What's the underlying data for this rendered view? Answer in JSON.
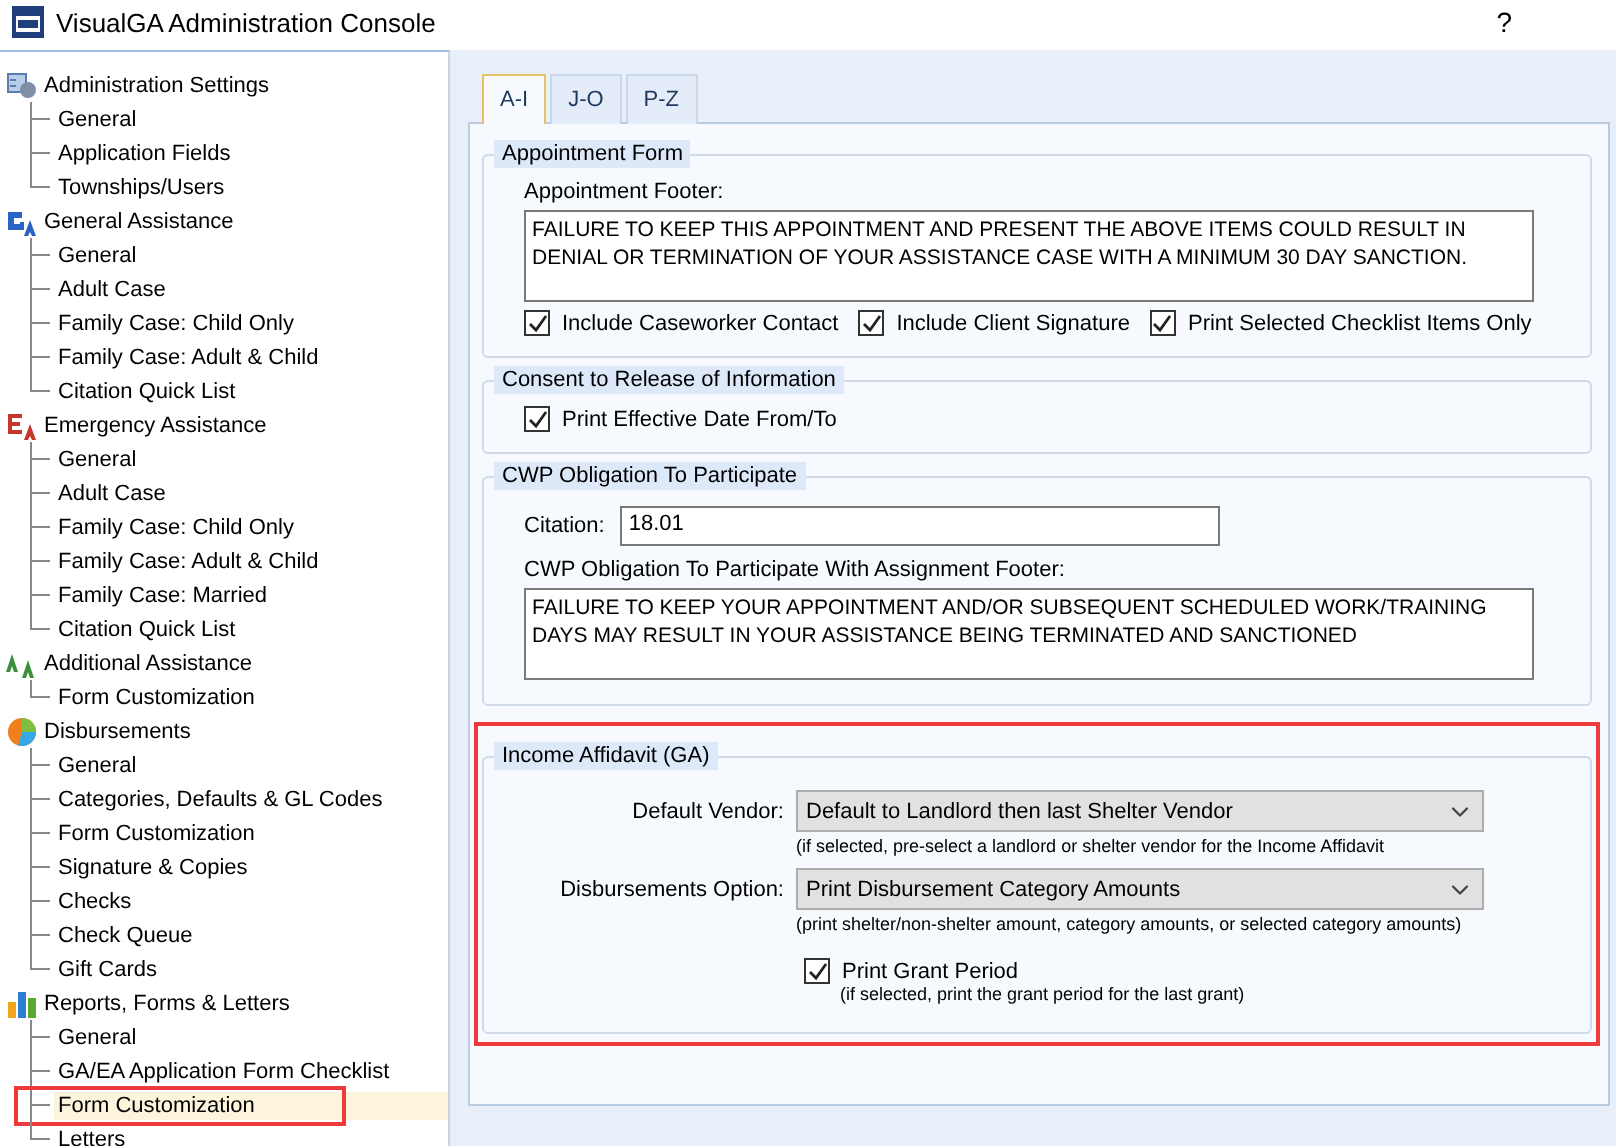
{
  "window": {
    "title": "VisualGA Administration Console",
    "help": "?"
  },
  "tree": [
    {
      "label": "Administration Settings",
      "kind": "settings",
      "children": [
        {
          "label": "General",
          "selected": false
        },
        {
          "label": "Application Fields",
          "selected": false
        },
        {
          "label": "Townships/Users",
          "selected": false
        }
      ]
    },
    {
      "label": "General Assistance",
      "kind": "ga",
      "children": [
        {
          "label": "General",
          "selected": false
        },
        {
          "label": "Adult Case",
          "selected": false
        },
        {
          "label": "Family Case: Child Only",
          "selected": false
        },
        {
          "label": "Family Case: Adult & Child",
          "selected": false
        },
        {
          "label": "Citation Quick List",
          "selected": false
        }
      ]
    },
    {
      "label": "Emergency Assistance",
      "kind": "ea",
      "children": [
        {
          "label": "General",
          "selected": false
        },
        {
          "label": "Adult Case",
          "selected": false
        },
        {
          "label": "Family Case: Child Only",
          "selected": false
        },
        {
          "label": "Family Case: Adult & Child",
          "selected": false
        },
        {
          "label": "Family Case: Married",
          "selected": false
        },
        {
          "label": "Citation Quick List",
          "selected": false
        }
      ]
    },
    {
      "label": "Additional Assistance",
      "kind": "aa",
      "children": [
        {
          "label": "Form Customization",
          "selected": false
        }
      ]
    },
    {
      "label": "Disbursements",
      "kind": "pie",
      "children": [
        {
          "label": "General",
          "selected": false
        },
        {
          "label": "Categories, Defaults & GL Codes",
          "selected": false
        },
        {
          "label": "Form Customization",
          "selected": false
        },
        {
          "label": "Signature & Copies",
          "selected": false
        },
        {
          "label": "Checks",
          "selected": false
        },
        {
          "label": "Check Queue",
          "selected": false
        },
        {
          "label": "Gift Cards",
          "selected": false
        }
      ]
    },
    {
      "label": "Reports, Forms & Letters",
      "kind": "bars",
      "children": [
        {
          "label": "General",
          "selected": false
        },
        {
          "label": "GA/EA Application Form Checklist",
          "selected": false
        },
        {
          "label": "Form Customization",
          "selected": true,
          "highlighted": true
        },
        {
          "label": "Letters",
          "selected": false
        }
      ]
    }
  ],
  "tabs": [
    {
      "label": "A-I",
      "selected": true
    },
    {
      "label": "J-O",
      "selected": false
    },
    {
      "label": "P-Z",
      "selected": false
    }
  ],
  "sections": [
    {
      "title": "Appointment Form",
      "highlighted": false,
      "items": [
        {
          "kind": "textarea",
          "label": "Appointment Footer:",
          "value": "FAILURE TO KEEP THIS APPOINTMENT AND PRESENT THE ABOVE ITEMS COULD RESULT IN DENIAL OR TERMINATION OF YOUR ASSISTANCE CASE WITH A MINIMUM 30 DAY SANCTION."
        },
        {
          "kind": "checkrow",
          "checks": [
            {
              "label": "Include Caseworker Contact",
              "checked": true
            },
            {
              "label": "Include Client Signature",
              "checked": true
            },
            {
              "label": "Print Selected Checklist Items Only",
              "checked": true
            }
          ]
        }
      ]
    },
    {
      "title": "Consent to Release of Information",
      "highlighted": false,
      "items": [
        {
          "kind": "checkrow",
          "checks": [
            {
              "label": "Print Effective Date From/To",
              "checked": true
            }
          ]
        }
      ]
    },
    {
      "title": "CWP Obligation To Participate",
      "highlighted": false,
      "items": [
        {
          "kind": "textfield",
          "label": "Citation:",
          "value": "18.01"
        },
        {
          "kind": "textarea",
          "label": "CWP Obligation To Participate With Assignment Footer:",
          "value": "FAILURE TO KEEP YOUR APPOINTMENT AND/OR SUBSEQUENT SCHEDULED WORK/TRAINING DAYS MAY RESULT IN YOUR ASSISTANCE BEING TERMINATED AND SANCTIONED"
        }
      ]
    },
    {
      "title": "Income Affidavit (GA)",
      "highlighted": true,
      "items": [
        {
          "kind": "dropdown",
          "label": "Default Vendor:",
          "value": "Default to Landlord then last Shelter Vendor",
          "hint": "(if selected, pre-select a landlord or shelter vendor for the Income Affidavit"
        },
        {
          "kind": "dropdown",
          "label": "Disbursements Option:",
          "value": "Print Disbursement Category Amounts",
          "hint": "(print shelter/non-shelter amount, category amounts, or selected category amounts)"
        },
        {
          "kind": "check",
          "label": "Print Grant Period",
          "checked": true,
          "hint": "(if selected, print the grant period for the last grant)"
        }
      ]
    }
  ]
}
